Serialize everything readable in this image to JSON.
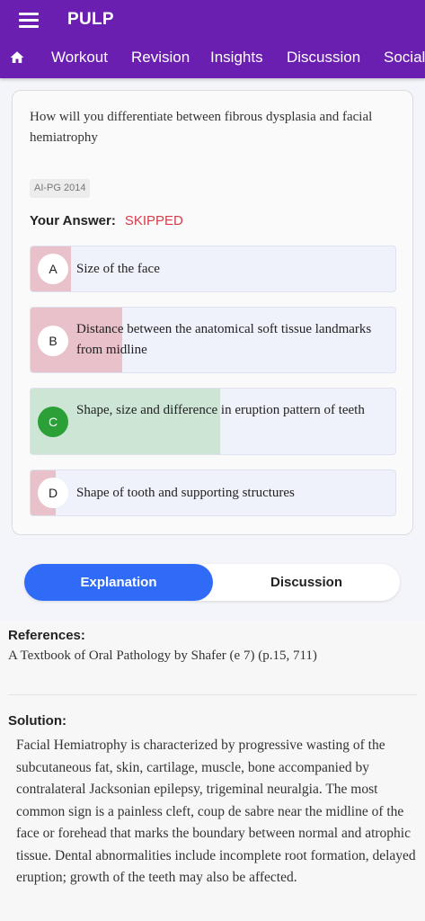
{
  "app": {
    "title": "PULP"
  },
  "nav": {
    "items": [
      "Workout",
      "Revision",
      "Insights",
      "Discussion",
      "Social"
    ]
  },
  "question": {
    "text": "How will you differentiate between fibrous dysplasia and facial hemiatrophy",
    "tag": "AI-PG 2014",
    "answer_label": "Your Answer:",
    "answer_value": "SKIPPED"
  },
  "options": [
    {
      "letter": "A",
      "text": "Size of the face",
      "percent": 11,
      "correct": false
    },
    {
      "letter": "B",
      "text": "Distance between the anatomical soft tissue landmarks from midline",
      "percent": 25,
      "correct": false
    },
    {
      "letter": "C",
      "text": "Shape, size and difference in eruption pattern of teeth",
      "percent": 52,
      "correct": true
    },
    {
      "letter": "D",
      "text": "Shape of tooth and supporting structures",
      "percent": 7,
      "correct": false
    }
  ],
  "tabs": {
    "explanation": "Explanation",
    "discussion": "Discussion"
  },
  "references": {
    "heading": "References:",
    "text": "A Textbook of Oral Pathology by Shafer (e 7) (p.15, 711)"
  },
  "solution": {
    "heading": "Solution:",
    "text": "Facial Hemiatrophy is characterized by progressive wasting of the subcutaneous fat, skin, cartilage, muscle, bone accompanied by contralateral Jacksonian epilepsy, trigeminal neuralgia. The most common sign is a painless cleft, coup de sabre near the midline of the face or forehead that marks the boundary between normal and atrophic tissue. Dental abnormalities include incomplete root formation, delayed eruption; growth of the teeth may also be affected."
  },
  "colors": {
    "header": "#6a1fb0",
    "accent": "#2f6bf6",
    "wrong_fill": "#e8c1ca",
    "correct_fill": "#cde5d5",
    "correct_badge": "#2aa036",
    "skipped": "#d93a4a"
  }
}
